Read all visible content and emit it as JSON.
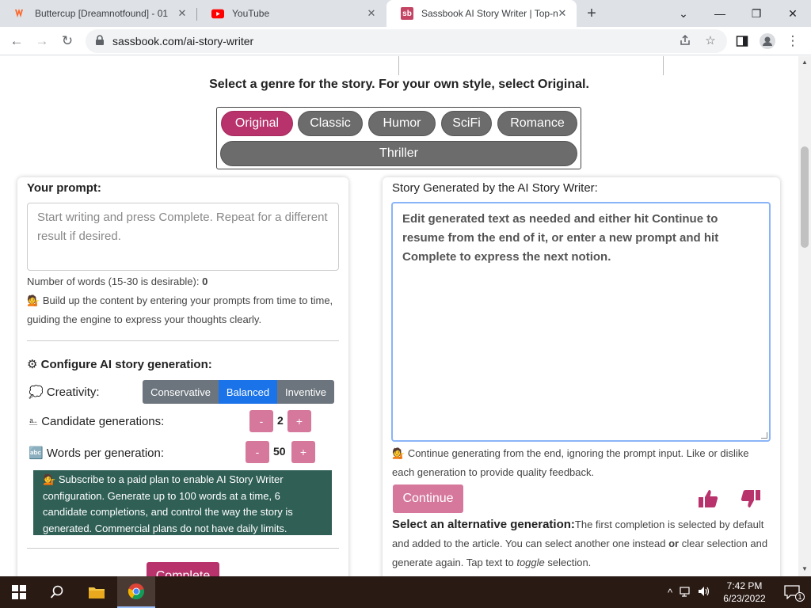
{
  "tabs": [
    {
      "title": "Buttercup [Dreamnotfound] - 01",
      "close": "✕"
    },
    {
      "title": "YouTube",
      "close": "✕"
    },
    {
      "title": "Sassbook AI Story Writer | Top-n",
      "close": "✕",
      "favicon_text": "sb"
    }
  ],
  "new_tab_label": "+",
  "window_controls": {
    "chevron": "⌄",
    "minimize": "—",
    "restore": "❐",
    "close": "✕"
  },
  "nav": {
    "back": "←",
    "forward": "→",
    "reload": "↻",
    "menu": "⋮"
  },
  "address": {
    "url": "sassbook.com/ai-story-writer"
  },
  "page": {
    "genre_prompt": "Select a genre for the story. For your own style, select Original.",
    "genres": [
      "Original",
      "Classic",
      "Humor",
      "SciFi",
      "Romance",
      "Thriller"
    ],
    "selected_genre": "Original",
    "left": {
      "prompt_label": "Your prompt:",
      "prompt_placeholder": "Start writing and press Complete. Repeat for a different result if desired.",
      "word_count_label": "Number of words (15-30 is desirable):",
      "word_count_value": "0",
      "tip_emoji": "💁",
      "tip_text": "Build up the content by entering your prompts from time to time, guiding the engine to express your thoughts clearly.",
      "config_icon": "⚙",
      "config_title": "Configure AI story generation:",
      "creativity_icon": "💭",
      "creativity_label": "Creativity:",
      "creativity_options": [
        "Conservative",
        "Balanced",
        "Inventive"
      ],
      "creativity_selected": "Balanced",
      "candidates_icon": "⎁",
      "candidates_label": "Candidate generations:",
      "candidates_value": "2",
      "words_icon": "🔤",
      "words_label": "Words per generation:",
      "words_value": "50",
      "minus": "-",
      "plus": "+",
      "notice_emoji": "💁",
      "notice_text": "Subscribe to a paid plan to enable AI Story Writer configuration. Generate up to 100 words at a time, 6 candidate completions, and control the way the story is generated. Commercial plans do not have daily limits.",
      "complete_button": "Complete"
    },
    "right": {
      "story_label": "Story Generated by the AI Story Writer:",
      "story_placeholder": "Edit generated text as needed and either hit Continue to resume from the end of it, or enter a new prompt and hit Complete to express the next notion.",
      "continue_tip_emoji": "💁",
      "continue_tip": "Continue generating from the end, ignoring the prompt input. Like or dislike each generation to provide quality feedback.",
      "continue_button": "Continue",
      "alt_title": "Select an alternative generation:",
      "alt_text_1": "The first completion is selected by default and added to the article. You can select another one instead ",
      "alt_or": "or",
      "alt_text_2": " clear selection and generate again. Tap text to ",
      "alt_toggle": "toggle",
      "alt_text_3": " selection."
    }
  },
  "taskbar": {
    "time": "7:42 PM",
    "date": "6/23/2022",
    "notification_count": "1"
  },
  "colors": {
    "accent_pink": "#b8326b",
    "button_pink": "#d5789c",
    "selected_blue": "#1a73e8",
    "notice_green": "#2f5f55"
  }
}
